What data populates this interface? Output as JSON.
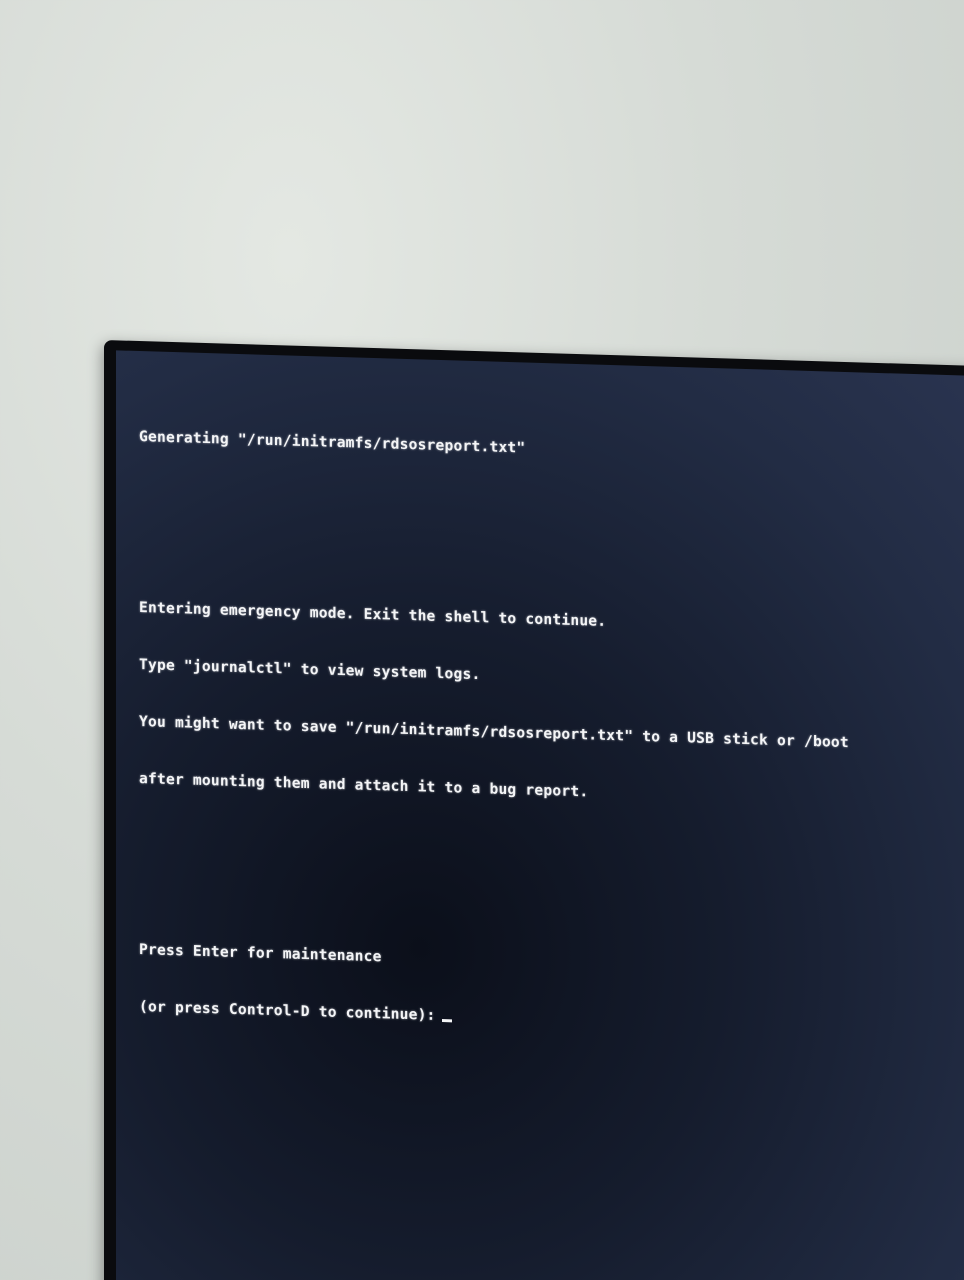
{
  "terminal": {
    "lines": [
      "Generating \"/run/initramfs/rdsosreport.txt\"",
      "",
      "",
      "Entering emergency mode. Exit the shell to continue.",
      "Type \"journalctl\" to view system logs.",
      "You might want to save \"/run/initramfs/rdsosreport.txt\" to a USB stick or /boot",
      "after mounting them and attach it to a bug report.",
      "",
      "",
      "Press Enter for maintenance"
    ],
    "prompt": "(or press Control-D to continue):"
  },
  "colors": {
    "terminal_text": "#f4f5f7",
    "screen_background": "#151c2d",
    "bezel": "#0a0b0e",
    "wall": "#d6dbd6"
  }
}
